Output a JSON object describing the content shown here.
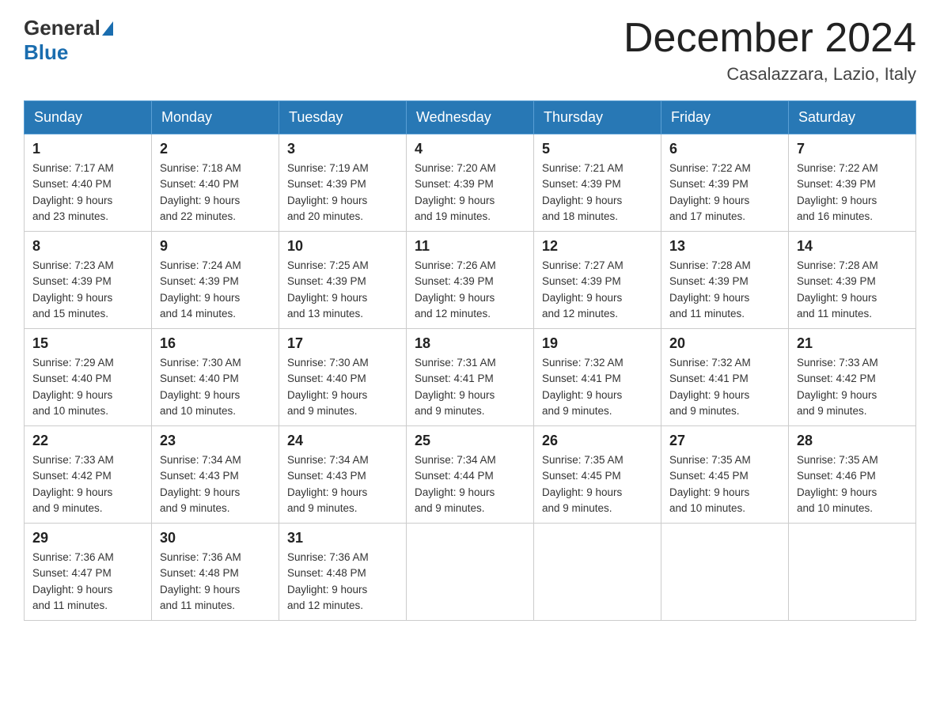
{
  "header": {
    "logo_general": "General",
    "logo_blue": "Blue",
    "month_title": "December 2024",
    "location": "Casalazzara, Lazio, Italy"
  },
  "days_of_week": [
    "Sunday",
    "Monday",
    "Tuesday",
    "Wednesday",
    "Thursday",
    "Friday",
    "Saturday"
  ],
  "weeks": [
    [
      {
        "day": "1",
        "sunrise": "7:17 AM",
        "sunset": "4:40 PM",
        "daylight": "9 hours and 23 minutes."
      },
      {
        "day": "2",
        "sunrise": "7:18 AM",
        "sunset": "4:40 PM",
        "daylight": "9 hours and 22 minutes."
      },
      {
        "day": "3",
        "sunrise": "7:19 AM",
        "sunset": "4:39 PM",
        "daylight": "9 hours and 20 minutes."
      },
      {
        "day": "4",
        "sunrise": "7:20 AM",
        "sunset": "4:39 PM",
        "daylight": "9 hours and 19 minutes."
      },
      {
        "day": "5",
        "sunrise": "7:21 AM",
        "sunset": "4:39 PM",
        "daylight": "9 hours and 18 minutes."
      },
      {
        "day": "6",
        "sunrise": "7:22 AM",
        "sunset": "4:39 PM",
        "daylight": "9 hours and 17 minutes."
      },
      {
        "day": "7",
        "sunrise": "7:22 AM",
        "sunset": "4:39 PM",
        "daylight": "9 hours and 16 minutes."
      }
    ],
    [
      {
        "day": "8",
        "sunrise": "7:23 AM",
        "sunset": "4:39 PM",
        "daylight": "9 hours and 15 minutes."
      },
      {
        "day": "9",
        "sunrise": "7:24 AM",
        "sunset": "4:39 PM",
        "daylight": "9 hours and 14 minutes."
      },
      {
        "day": "10",
        "sunrise": "7:25 AM",
        "sunset": "4:39 PM",
        "daylight": "9 hours and 13 minutes."
      },
      {
        "day": "11",
        "sunrise": "7:26 AM",
        "sunset": "4:39 PM",
        "daylight": "9 hours and 12 minutes."
      },
      {
        "day": "12",
        "sunrise": "7:27 AM",
        "sunset": "4:39 PM",
        "daylight": "9 hours and 12 minutes."
      },
      {
        "day": "13",
        "sunrise": "7:28 AM",
        "sunset": "4:39 PM",
        "daylight": "9 hours and 11 minutes."
      },
      {
        "day": "14",
        "sunrise": "7:28 AM",
        "sunset": "4:39 PM",
        "daylight": "9 hours and 11 minutes."
      }
    ],
    [
      {
        "day": "15",
        "sunrise": "7:29 AM",
        "sunset": "4:40 PM",
        "daylight": "9 hours and 10 minutes."
      },
      {
        "day": "16",
        "sunrise": "7:30 AM",
        "sunset": "4:40 PM",
        "daylight": "9 hours and 10 minutes."
      },
      {
        "day": "17",
        "sunrise": "7:30 AM",
        "sunset": "4:40 PM",
        "daylight": "9 hours and 9 minutes."
      },
      {
        "day": "18",
        "sunrise": "7:31 AM",
        "sunset": "4:41 PM",
        "daylight": "9 hours and 9 minutes."
      },
      {
        "day": "19",
        "sunrise": "7:32 AM",
        "sunset": "4:41 PM",
        "daylight": "9 hours and 9 minutes."
      },
      {
        "day": "20",
        "sunrise": "7:32 AM",
        "sunset": "4:41 PM",
        "daylight": "9 hours and 9 minutes."
      },
      {
        "day": "21",
        "sunrise": "7:33 AM",
        "sunset": "4:42 PM",
        "daylight": "9 hours and 9 minutes."
      }
    ],
    [
      {
        "day": "22",
        "sunrise": "7:33 AM",
        "sunset": "4:42 PM",
        "daylight": "9 hours and 9 minutes."
      },
      {
        "day": "23",
        "sunrise": "7:34 AM",
        "sunset": "4:43 PM",
        "daylight": "9 hours and 9 minutes."
      },
      {
        "day": "24",
        "sunrise": "7:34 AM",
        "sunset": "4:43 PM",
        "daylight": "9 hours and 9 minutes."
      },
      {
        "day": "25",
        "sunrise": "7:34 AM",
        "sunset": "4:44 PM",
        "daylight": "9 hours and 9 minutes."
      },
      {
        "day": "26",
        "sunrise": "7:35 AM",
        "sunset": "4:45 PM",
        "daylight": "9 hours and 9 minutes."
      },
      {
        "day": "27",
        "sunrise": "7:35 AM",
        "sunset": "4:45 PM",
        "daylight": "9 hours and 10 minutes."
      },
      {
        "day": "28",
        "sunrise": "7:35 AM",
        "sunset": "4:46 PM",
        "daylight": "9 hours and 10 minutes."
      }
    ],
    [
      {
        "day": "29",
        "sunrise": "7:36 AM",
        "sunset": "4:47 PM",
        "daylight": "9 hours and 11 minutes."
      },
      {
        "day": "30",
        "sunrise": "7:36 AM",
        "sunset": "4:48 PM",
        "daylight": "9 hours and 11 minutes."
      },
      {
        "day": "31",
        "sunrise": "7:36 AM",
        "sunset": "4:48 PM",
        "daylight": "9 hours and 12 minutes."
      },
      null,
      null,
      null,
      null
    ]
  ],
  "labels": {
    "sunrise": "Sunrise:",
    "sunset": "Sunset:",
    "daylight": "Daylight:"
  }
}
